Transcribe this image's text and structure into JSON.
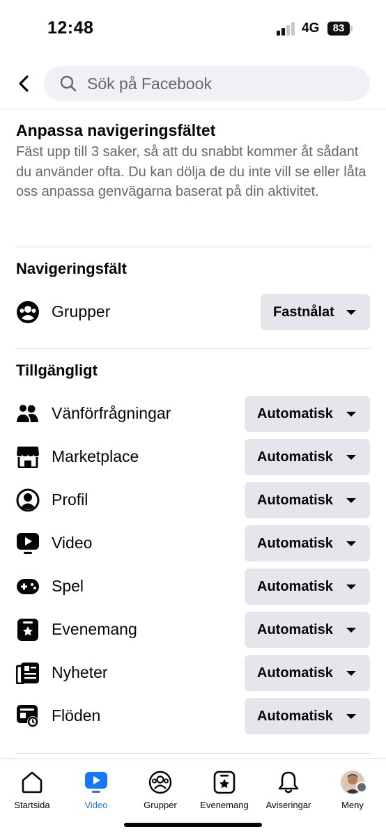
{
  "status": {
    "time": "12:48",
    "network": "4G",
    "battery": "83"
  },
  "search": {
    "placeholder": "Sök på Facebook"
  },
  "intro": {
    "title": "Anpassa navigeringsfältet",
    "description": "Fäst upp till 3 saker, så att du snabbt kommer åt sådant du använder ofta. Du kan dölja de du inte vill se eller låta oss anpassa genvägarna baserat på din aktivitet."
  },
  "navbar_section": {
    "title": "Navigeringsfält",
    "items": [
      {
        "label": "Grupper",
        "setting": "Fastnålat",
        "icon": "groups-icon"
      }
    ]
  },
  "available_section": {
    "title": "Tillgängligt",
    "items": [
      {
        "label": "Vänförfrågningar",
        "setting": "Automatisk",
        "icon": "friends-icon"
      },
      {
        "label": "Marketplace",
        "setting": "Automatisk",
        "icon": "marketplace-icon"
      },
      {
        "label": "Profil",
        "setting": "Automatisk",
        "icon": "profile-icon"
      },
      {
        "label": "Video",
        "setting": "Automatisk",
        "icon": "video-icon"
      },
      {
        "label": "Spel",
        "setting": "Automatisk",
        "icon": "gaming-icon"
      },
      {
        "label": "Evenemang",
        "setting": "Automatisk",
        "icon": "events-icon"
      },
      {
        "label": "Nyheter",
        "setting": "Automatisk",
        "icon": "news-icon"
      },
      {
        "label": "Flöden",
        "setting": "Automatisk",
        "icon": "feeds-icon"
      }
    ]
  },
  "tabbar": {
    "tabs": [
      {
        "label": "Startsida",
        "icon": "home-icon",
        "active": false
      },
      {
        "label": "Video",
        "icon": "video-icon",
        "active": true
      },
      {
        "label": "Grupper",
        "icon": "groups-icon",
        "active": false
      },
      {
        "label": "Evenemang",
        "icon": "events-icon",
        "active": false
      },
      {
        "label": "Aviseringar",
        "icon": "bell-icon",
        "active": false
      },
      {
        "label": "Meny",
        "icon": "avatar-icon",
        "active": false
      }
    ]
  },
  "colors": {
    "accent": "#1877f2",
    "muted_text": "#65676b",
    "button_bg": "#e4e6eb"
  }
}
